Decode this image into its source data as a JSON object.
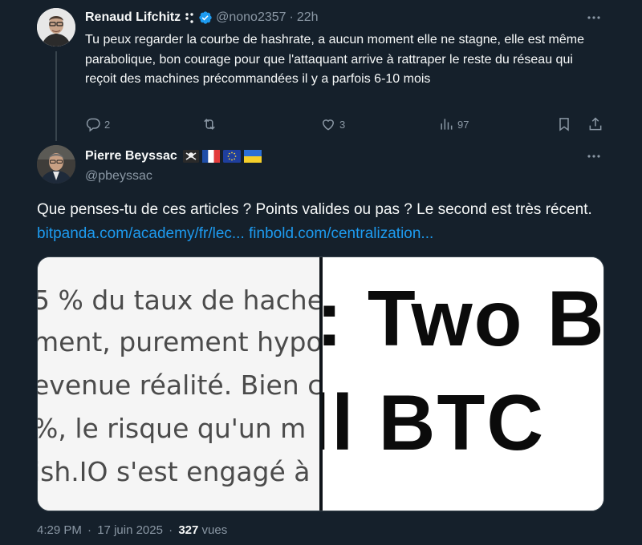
{
  "reply": {
    "author_name": "Renaud Lifchitz",
    "name_emoji": "⠑",
    "handle": "@nono2357",
    "separator": "·",
    "time": "22h",
    "text": "Tu peux regarder la courbe de hashrate, a aucun moment elle ne stagne, elle est même parabolique, bon courage pour que l'attaquant arrive à rattraper le reste du réseau qui reçoit des machines précommandées il y a parfois 6-10 mois",
    "actions": {
      "replies": "2",
      "retweets": "",
      "likes": "3",
      "views": "97"
    }
  },
  "tweet": {
    "author_name": "Pierre Beyssac",
    "handle": "@pbeyssac",
    "flags": [
      "pirate-flag",
      "france-flag",
      "eu-flag",
      "ukraine-flag"
    ],
    "text_main": "Que penses-tu de ces articles ? Points valides ou pas ? Le second est très récent.",
    "link1": "bitpanda.com/academy/fr/lec...",
    "link2": "finbold.com/centralization...",
    "media": {
      "left_lines": [
        "5 % du taux de hache",
        "ment, purement hypo",
        "evenue réalité. Bien c",
        "%, le risque qu'un m",
        "ish.IO s'est engagé à"
      ],
      "right_lines": [
        ": Two B",
        "ll BTC"
      ]
    },
    "time": "4:29 PM",
    "separator": "·",
    "date": "17 juin 2025",
    "views_count": "327",
    "views_label": "vues"
  },
  "colors": {
    "background": "#15202b",
    "text": "#f7f9f9",
    "secondary": "#8b98a5",
    "link": "#1d9bf0",
    "verified": "#1d9bf0"
  }
}
